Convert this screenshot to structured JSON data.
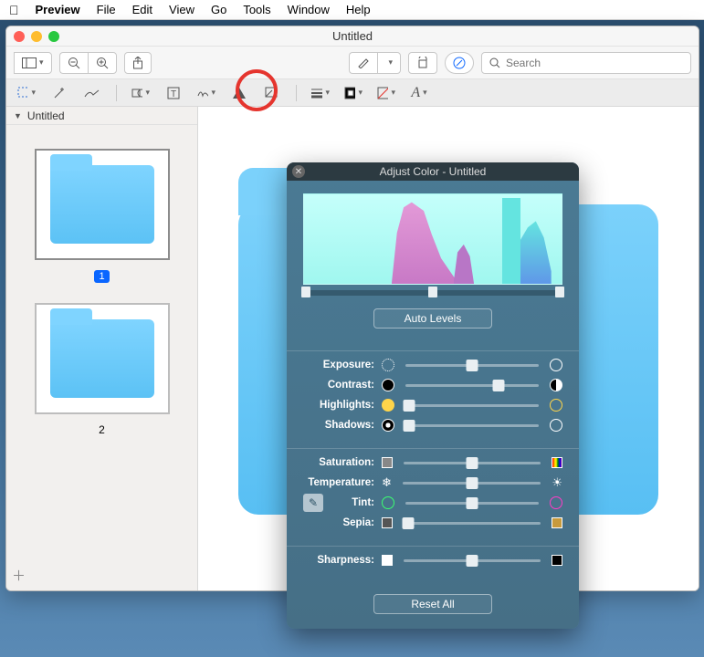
{
  "menubar": {
    "app": "Preview",
    "items": [
      "File",
      "Edit",
      "View",
      "Go",
      "Tools",
      "Window",
      "Help"
    ]
  },
  "window": {
    "title": "Untitled",
    "search_placeholder": "Search"
  },
  "sidebar": {
    "header": "Untitled",
    "pages": [
      {
        "label": "1"
      },
      {
        "label": "2"
      }
    ]
  },
  "panel": {
    "title": "Adjust Color - Untitled",
    "auto_levels": "Auto Levels",
    "reset_all": "Reset All",
    "sliders": {
      "exposure": {
        "label": "Exposure:",
        "pos": 50
      },
      "contrast": {
        "label": "Contrast:",
        "pos": 70
      },
      "highlights": {
        "label": "Highlights:",
        "pos": 3
      },
      "shadows": {
        "label": "Shadows:",
        "pos": 3
      },
      "saturation": {
        "label": "Saturation:",
        "pos": 50
      },
      "temperature": {
        "label": "Temperature:",
        "pos": 50
      },
      "tint": {
        "label": "Tint:",
        "pos": 50
      },
      "sepia": {
        "label": "Sepia:",
        "pos": 3
      },
      "sharpness": {
        "label": "Sharpness:",
        "pos": 50
      }
    }
  }
}
